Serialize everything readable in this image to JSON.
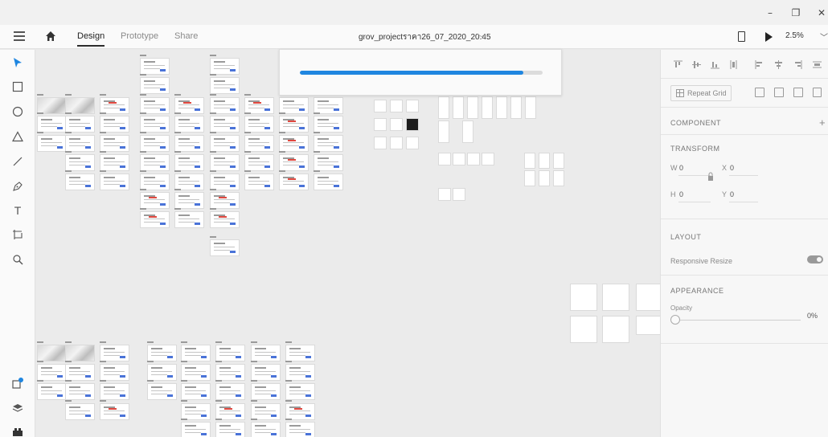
{
  "window": {
    "minimize_glyph": "–",
    "restore_glyph": "❐",
    "close_glyph": "✕"
  },
  "header": {
    "tabs": [
      {
        "label": "Design",
        "active": true
      },
      {
        "label": "Prototype",
        "active": false
      },
      {
        "label": "Share",
        "active": false
      }
    ],
    "document_title": "grov_projectราคา26_07_2020_20.45",
    "chevron_glyph": "﹀",
    "zoom": "2.5%"
  },
  "tools": [
    "select-icon",
    "rectangle-icon",
    "ellipse-icon",
    "polygon-icon",
    "line-icon",
    "pen-icon",
    "text-icon",
    "artboard-icon",
    "zoom-icon",
    "plugins-icon",
    "layers-icon",
    "assets-icon"
  ],
  "text_tool_glyph": "T",
  "progress": {
    "fraction": 0.92,
    "color": "#1f86e0"
  },
  "panel": {
    "repeat_grid_label": "Repeat Grid",
    "component_title": "COMPONENT",
    "plus_glyph": "+",
    "transform_title": "TRANSFORM",
    "w_label": "W",
    "w_value": "0",
    "x_label": "X",
    "x_value": "0",
    "h_label": "H",
    "h_value": "0",
    "y_label": "Y",
    "y_value": "0",
    "layout_title": "LAYOUT",
    "responsive_label": "Responsive Resize",
    "appearance_title": "APPEARANCE",
    "opacity_label": "Opacity",
    "opacity_value": "0%"
  },
  "colors": {
    "accent": "#1f86e0",
    "canvas": "#ebebeb",
    "panel": "#f7f7f7"
  }
}
